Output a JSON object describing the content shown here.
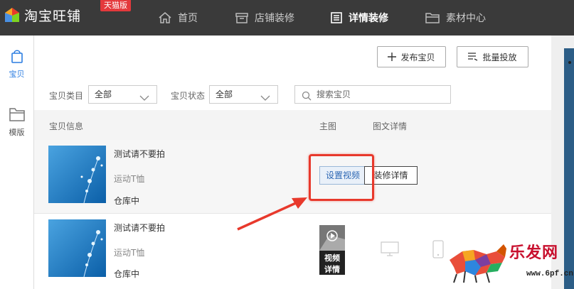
{
  "app": {
    "logo_text": "淘宝旺铺",
    "badge": "天猫版"
  },
  "nav": [
    {
      "label": "首页",
      "icon": "home-icon"
    },
    {
      "label": "店铺装修",
      "icon": "store-icon"
    },
    {
      "label": "详情装修",
      "icon": "detail-icon",
      "active": true
    },
    {
      "label": "素材中心",
      "icon": "folder-icon"
    }
  ],
  "sidebar": [
    {
      "label": "宝贝",
      "icon": "bag-icon",
      "active": true
    },
    {
      "label": "模版",
      "icon": "folder-icon"
    }
  ],
  "toolbar": {
    "publish_label": "发布宝贝",
    "batch_label": "批量投放"
  },
  "filters": {
    "category_label": "宝贝类目",
    "category_value": "全部",
    "status_label": "宝贝状态",
    "status_value": "全部",
    "search_placeholder": "搜索宝贝"
  },
  "table": {
    "headers": [
      "宝贝信息",
      "主图",
      "图文详情"
    ]
  },
  "items": [
    {
      "name": "测试请不要拍",
      "category": "运动T恤",
      "status": "仓库中",
      "set_video_label": "设置视频",
      "decorate_label": "装修详情"
    },
    {
      "name": "测试请不要拍",
      "category": "运动T恤",
      "status": "仓库中",
      "video_label_1": "视频",
      "video_label_2": "详情"
    }
  ],
  "watermark": {
    "text": "乐发网",
    "url": "www.6pf.cn"
  },
  "colors": {
    "topbar": "#3a3a3a",
    "accent_blue": "#2b7de1",
    "highlight_red": "#e8392c",
    "badge_red": "#e4393c"
  }
}
